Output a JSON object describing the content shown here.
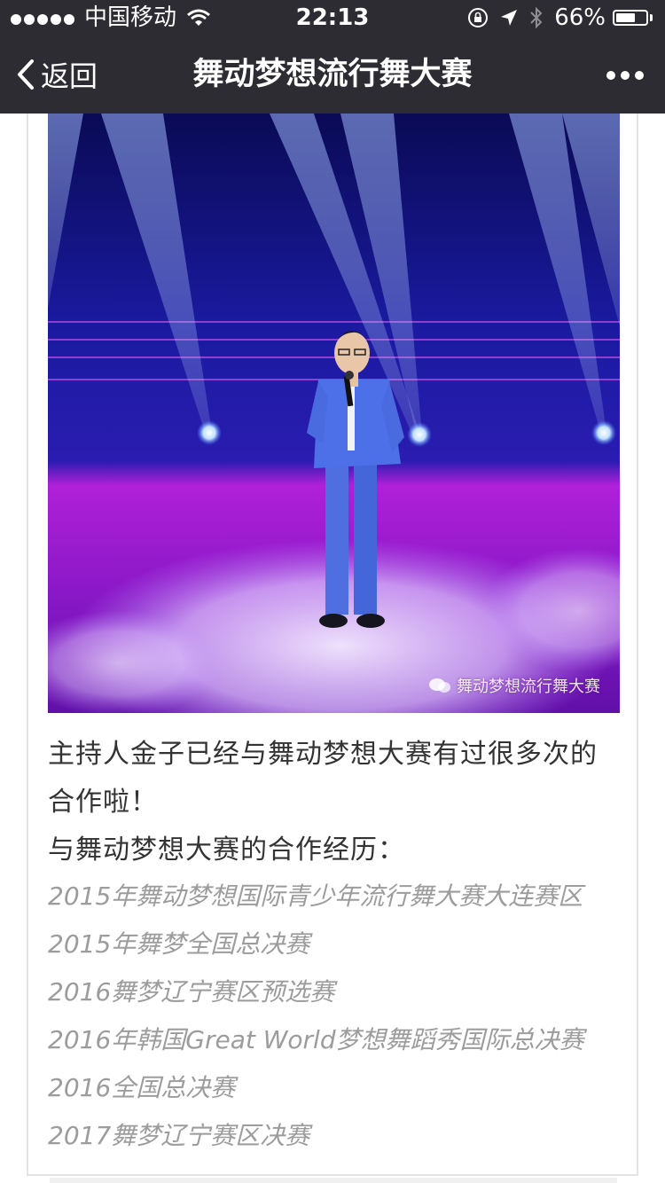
{
  "status_bar": {
    "carrier": "中国移动",
    "time": "22:13",
    "battery_percent": "66%",
    "battery_level": 0.66,
    "signal_bars": 5,
    "icons": [
      "signal-dots-icon",
      "wifi-icon",
      "orientation-lock-icon",
      "location-arrow-icon",
      "bluetooth-icon",
      "battery-icon"
    ]
  },
  "nav": {
    "back_label": "返回",
    "title": "舞动梦想流行舞大赛",
    "back_icon": "chevron-left-icon",
    "more_icon": "more-dots-icon"
  },
  "article": {
    "image": {
      "description_icon": "stage-photo",
      "watermark": "舞动梦想流行舞大赛",
      "watermark_icon": "wechat-icon"
    },
    "intro_line": "主持人金子已经与舞动梦想大赛有过很多次的合作啦！",
    "history_heading": "与舞动梦想大赛的合作经历：",
    "history": [
      "2015年舞动梦想国际青少年流行舞大赛大连赛区",
      "2015年舞梦全国总决赛",
      "2016舞梦辽宁赛区预选赛",
      "2016年韩国Great World梦想舞蹈秀国际总决赛",
      "2016全国总决赛",
      "2017舞梦辽宁赛区决赛"
    ]
  },
  "colors": {
    "nav_bg": "#2c2c32",
    "text_primary": "#333333",
    "text_muted": "#9c9c9c",
    "card_border": "#e4e4e4"
  }
}
